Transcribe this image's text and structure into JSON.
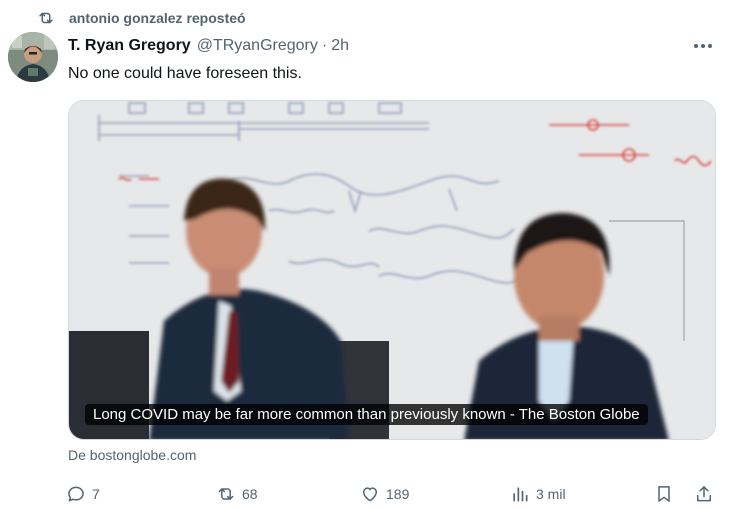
{
  "repost": {
    "text": "antonio gonzalez reposteó"
  },
  "author": {
    "name": "T. Ryan Gregory",
    "handle": "@TRyanGregory",
    "separator": "·",
    "time": "2h"
  },
  "post": {
    "text": "No one could have foreseen this."
  },
  "card": {
    "caption": "Long COVID may be far more common than previously known - The Boston Globe"
  },
  "source": {
    "text": "De bostonglobe.com"
  },
  "actions": {
    "replies": "7",
    "reposts": "68",
    "likes": "189",
    "views": "3 mil"
  },
  "colors": {
    "muted": "#536471",
    "text": "#0f1419",
    "border": "#cfd9de"
  },
  "icons": [
    "repost-icon",
    "more-icon",
    "reply-icon",
    "like-icon",
    "views-icon",
    "bookmark-icon",
    "share-icon"
  ]
}
